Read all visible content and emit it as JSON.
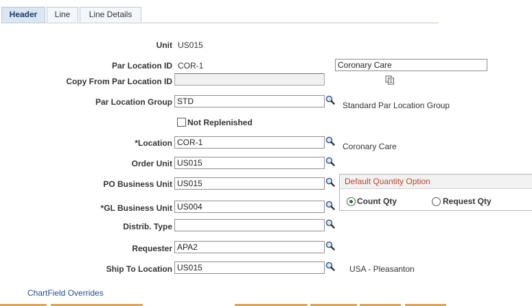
{
  "tabs": [
    {
      "label": "Header"
    },
    {
      "label": "Line"
    },
    {
      "label": "Line Details"
    }
  ],
  "form": {
    "unit": {
      "label": "Unit",
      "value": "US015"
    },
    "par_location_id": {
      "label": "Par Location ID",
      "value": "COR-1",
      "description": "Coronary Care"
    },
    "copy_from": {
      "label": "Copy From Par Location ID",
      "value": ""
    },
    "par_location_group": {
      "label": "Par Location Group",
      "value": "STD",
      "description": "Standard Par Location Group"
    },
    "not_replenished": {
      "label": "Not Replenished",
      "checked": false
    },
    "location": {
      "label": "*Location",
      "value": "COR-1",
      "description": "Coronary Care"
    },
    "order_unit": {
      "label": "Order Unit",
      "value": "US015"
    },
    "po_business_unit": {
      "label": "PO Business Unit",
      "value": "US015"
    },
    "gl_business_unit": {
      "label": "*GL Business Unit",
      "value": "US004"
    },
    "distrib_type": {
      "label": "Distrib. Type",
      "value": ""
    },
    "requester": {
      "label": "Requester",
      "value": "APA2"
    },
    "ship_to_location": {
      "label": "Ship To Location",
      "value": "US015",
      "description": "USA - Pleasanton"
    }
  },
  "default_quantity": {
    "title": "Default Quantity Option",
    "options": [
      {
        "label": "Count Qty",
        "selected": true
      },
      {
        "label": "Request Qty",
        "selected": false
      }
    ]
  },
  "links": {
    "chartfield_overrides": "ChartField Overrides"
  },
  "colors": {
    "tab_active_bg": "#dbe6f3",
    "group_title": "#b8452a",
    "link": "#1d4e8f",
    "radio_selected": "#1d7a2f"
  },
  "icons": {
    "lookup": "magnifier-icon",
    "copy": "copy-icon"
  }
}
